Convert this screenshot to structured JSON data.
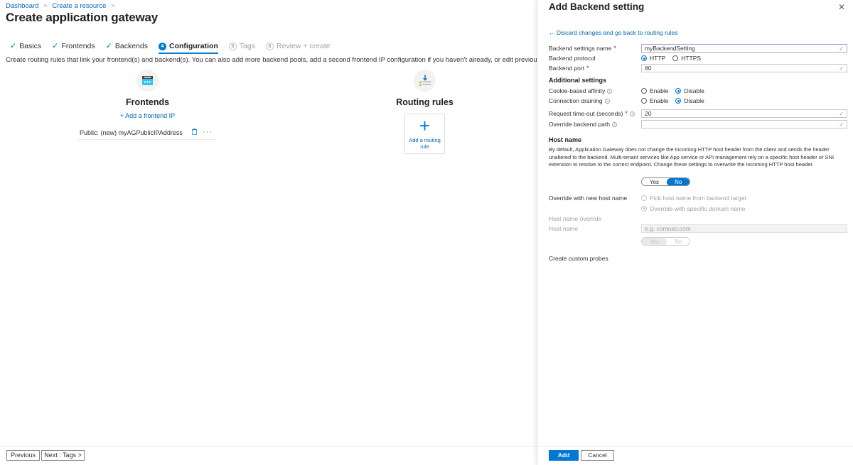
{
  "breadcrumb": {
    "items": [
      "Dashboard",
      "Create a resource"
    ],
    "separator": ">"
  },
  "page": {
    "title": "Create application gateway",
    "title_overflow": "···",
    "intro": "Create routing rules that link your frontend(s) and backend(s). You can also add more backend pools, add a second frontend IP configuration if you haven't already, or edit previous configurations."
  },
  "tabs": [
    {
      "label": "Basics",
      "state": "complete",
      "marker": "✓"
    },
    {
      "label": "Frontends",
      "state": "complete",
      "marker": "✓"
    },
    {
      "label": "Backends",
      "state": "complete",
      "marker": "✓"
    },
    {
      "label": "Configuration",
      "state": "active",
      "marker": "4"
    },
    {
      "label": "Tags",
      "state": "disabled",
      "marker": "5"
    },
    {
      "label": "Review + create",
      "state": "disabled",
      "marker": "6"
    }
  ],
  "frontends": {
    "icon": "browser-window-icon",
    "label": "Frontends",
    "add_link": "+ Add a frontend IP",
    "rows": [
      {
        "name": "Public: (new) myAGPublicIPAddress",
        "delete_icon": "trash-icon",
        "more_icon": "ellipsis-icon"
      }
    ]
  },
  "routing_rules": {
    "icon": "routing-rules-icon",
    "label": "Routing rules",
    "add_tile": {
      "plus": "+",
      "label": "Add a routing rule"
    }
  },
  "left_footer": {
    "previous": "Previous",
    "next": "Next : Tags >"
  },
  "panel": {
    "title": "Add Backend setting",
    "close_icon": "✕",
    "back_link": "← Discard changes and go back to routing rules",
    "fields": {
      "backend_settings_name": {
        "label": "Backend settings name",
        "required": "*",
        "value": "myBackendSetting",
        "validated": "✓"
      },
      "backend_protocol": {
        "label": "Backend protocol",
        "options": [
          "HTTP",
          "HTTPS"
        ],
        "selected": "HTTP"
      },
      "backend_port": {
        "label": "Backend port",
        "required": "*",
        "value": "80",
        "validated": "✓"
      }
    },
    "additional_settings": {
      "heading": "Additional settings",
      "cookie_affinity": {
        "label": "Cookie-based affinity",
        "info": "ⓘ",
        "options": [
          "Enable",
          "Disable"
        ],
        "selected": "Disable"
      },
      "connection_draining": {
        "label": "Connection draining",
        "info": "ⓘ",
        "options": [
          "Enable",
          "Disable"
        ],
        "selected": "Disable"
      },
      "request_timeout": {
        "label": "Request time-out (seconds)",
        "required": "*",
        "info": "ⓘ",
        "value": "20",
        "validated": "✓"
      },
      "override_backend_path": {
        "label": "Override backend path",
        "info": "ⓘ",
        "value": "",
        "validated": "✓"
      }
    },
    "host_name": {
      "heading": "Host name",
      "description": "By default, Application Gateway does not change the incoming HTTP host header from the client and sends the header unaltered to the backend. Multi-tenant services like App service or API management rely on a specific host header or SNI extension to resolve to the correct endpoint. Change these settings to overwrite the incoming HTTP host header.",
      "toggle": {
        "options": [
          "Yes",
          "No"
        ],
        "selected": "No"
      },
      "override_new_host_name": {
        "label": "Override with new host name",
        "options": [
          "Pick host name from backend target",
          "Override with specific domain name"
        ],
        "selected": "Override with specific domain name",
        "disabled": true
      },
      "host_name_override_label": "Host name override",
      "host_name_field": {
        "label": "Host name",
        "placeholder": "e.g. contoso.com",
        "value": "",
        "disabled": true
      },
      "host_name_toggle": {
        "options": [
          "Yes",
          "No"
        ],
        "selected": "Yes",
        "disabled": true
      },
      "create_custom_probes_label": "Create custom probes"
    },
    "footer": {
      "add": "Add",
      "cancel": "Cancel"
    }
  },
  "colors": {
    "accent": "#0078d4",
    "link": "#0067b8",
    "required": "#a4262c",
    "validated_border": "#b4a0cf",
    "frontend_icon": "#31c5f4"
  }
}
